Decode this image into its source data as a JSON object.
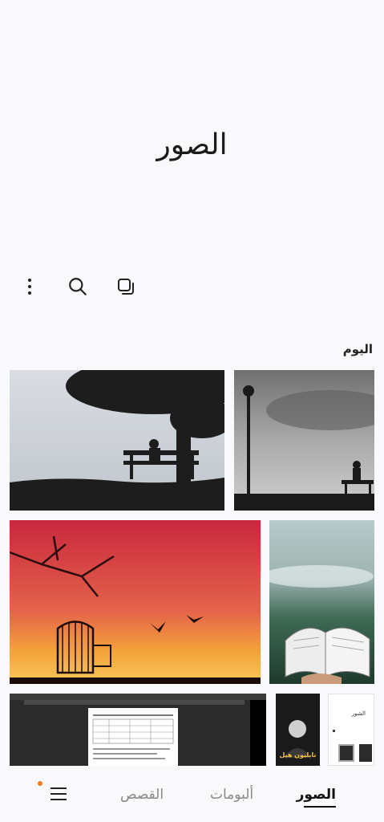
{
  "app": {
    "title": "الصور"
  },
  "toolbar": {
    "icons": [
      "more-vertical-icon",
      "search-icon",
      "select-icon"
    ]
  },
  "section": {
    "label": "اليوم"
  },
  "thumbnails": [
    {
      "name": "photo-tree-bench"
    },
    {
      "name": "photo-lamp-bench"
    },
    {
      "name": "photo-birdcage-sunset"
    },
    {
      "name": "photo-book-forest"
    },
    {
      "name": "photo-screenshot-document"
    },
    {
      "name": "photo-book-cover"
    },
    {
      "name": "photo-note"
    }
  ],
  "book_cover_text": "نابليون هيل",
  "note_text": "الشور",
  "nav": {
    "photos": "الصور",
    "albums": "ألبومات",
    "stories": "القصص"
  },
  "colors": {
    "notification_dot": "#f07a20",
    "active_tab": "#111111",
    "inactive_tab": "#888888"
  }
}
